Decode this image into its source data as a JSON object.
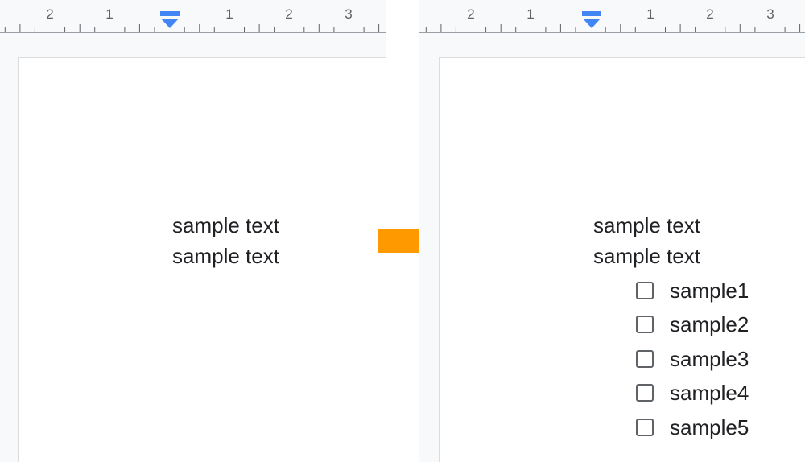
{
  "colors": {
    "accent": "#4285f4",
    "arrow": "#ff9900",
    "canvas_bg": "#f8f9fa",
    "text": "#202124",
    "ruler_text": "#5f6368"
  },
  "before": {
    "ruler": {
      "numbers": [
        "2",
        "1",
        "1",
        "2",
        "3"
      ],
      "indent_marker_icon": "indent-marker-icon"
    },
    "lines": [
      "sample text",
      "sample text"
    ]
  },
  "transition_icon": "right-arrow-icon",
  "after": {
    "ruler": {
      "numbers": [
        "2",
        "1",
        "1",
        "2",
        "3"
      ],
      "indent_marker_icon": "indent-marker-icon"
    },
    "lines": [
      "sample text",
      "sample text"
    ],
    "checklist": [
      {
        "label": "sample1",
        "checked": false
      },
      {
        "label": "sample2",
        "checked": false
      },
      {
        "label": "sample3",
        "checked": false
      },
      {
        "label": "sample4",
        "checked": false
      },
      {
        "label": "sample5",
        "checked": false
      }
    ]
  }
}
